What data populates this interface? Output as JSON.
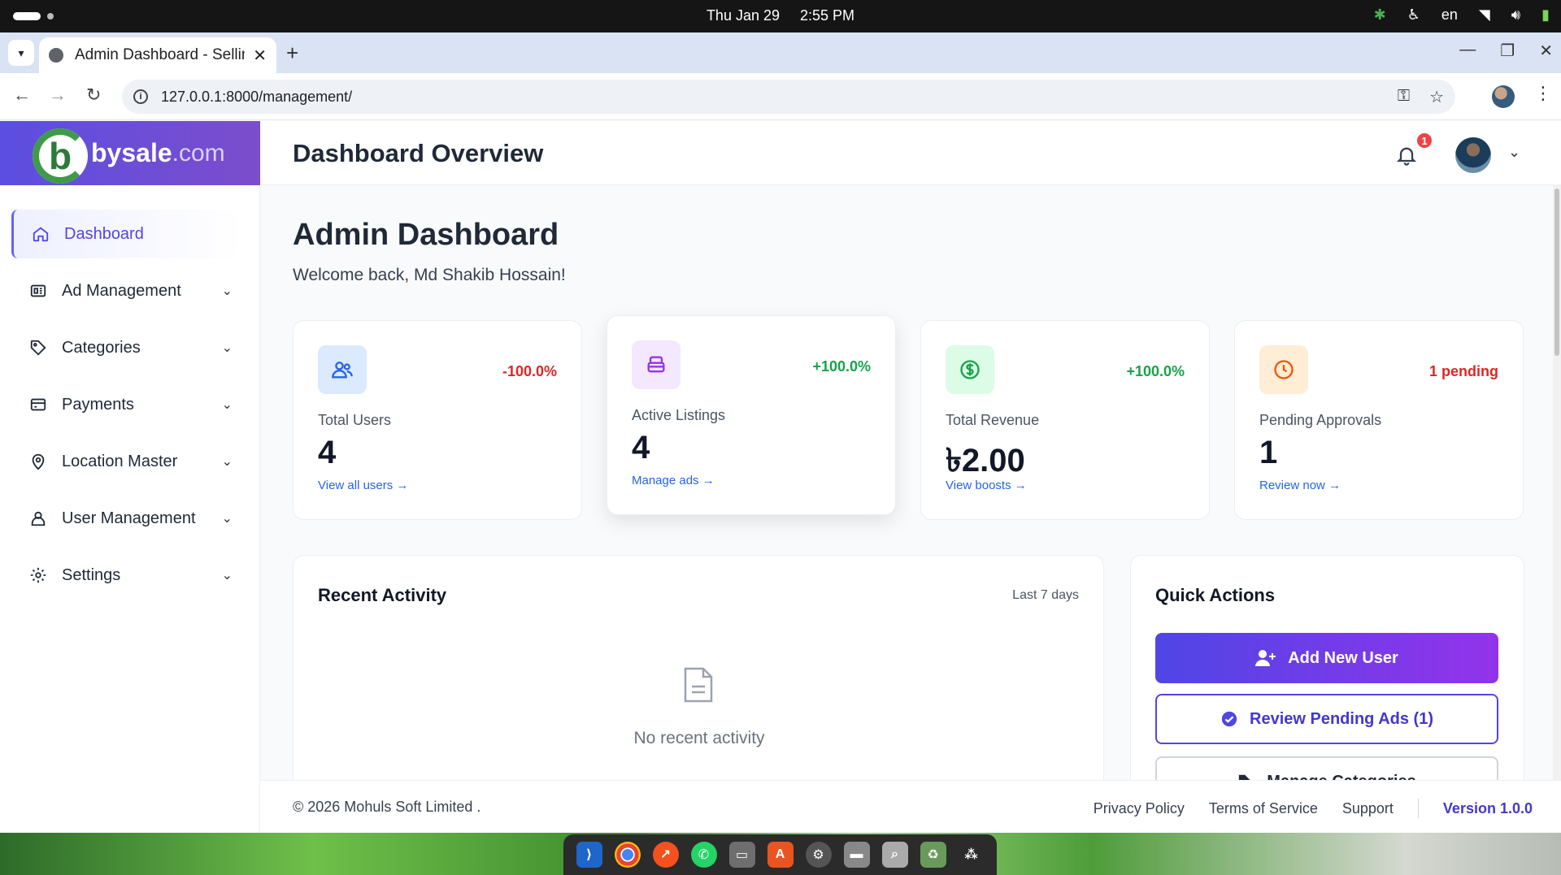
{
  "os": {
    "date": "Thu Jan 29",
    "time": "2:55 PM",
    "lang": "en"
  },
  "browser": {
    "tab_title": "Admin Dashboard - Sellin",
    "url": "127.0.0.1:8000/management/"
  },
  "brand": {
    "logo_letter": "b",
    "name": "bysale",
    "tld": ".com"
  },
  "sidebar": {
    "items": [
      {
        "label": "Dashboard",
        "icon": "home-icon",
        "active": true
      },
      {
        "label": "Ad Management",
        "icon": "ad-icon"
      },
      {
        "label": "Categories",
        "icon": "tag-icon"
      },
      {
        "label": "Payments",
        "icon": "credit-card-icon"
      },
      {
        "label": "Location Master",
        "icon": "location-pin-icon"
      },
      {
        "label": "User Management",
        "icon": "users-icon"
      },
      {
        "label": "Settings",
        "icon": "gear-icon"
      }
    ]
  },
  "header": {
    "title": "Dashboard Overview",
    "notification_count": "1"
  },
  "main": {
    "title": "Admin Dashboard",
    "welcome": "Welcome back, Md Shakib Hossain!"
  },
  "stats": [
    {
      "label": "Total Users",
      "value": "4",
      "change": "-100.0%",
      "link": "View all users →",
      "icon": "users-icon",
      "color": "#dc2626",
      "bg": "#dbeafe",
      "fg": "#2563eb"
    },
    {
      "label": "Active Listings",
      "value": "4",
      "change": "+100.0%",
      "link": "Manage ads →",
      "icon": "inbox-icon",
      "color": "#16a34a",
      "bg": "#f3e8ff",
      "fg": "#9333ea"
    },
    {
      "label": "Total Revenue",
      "value": "৳2.00",
      "change": "+100.0%",
      "link": "View boosts →",
      "icon": "dollar-icon",
      "color": "#16a34a",
      "bg": "#dcfce7",
      "fg": "#16a34a"
    },
    {
      "label": "Pending Approvals",
      "value": "1",
      "change": "1 pending",
      "link": "Review now →",
      "icon": "clock-icon",
      "color": "#dc2626",
      "bg": "#ffedd5",
      "fg": "#ea580c"
    }
  ],
  "activity": {
    "title": "Recent Activity",
    "period": "Last 7 days",
    "empty": "No recent activity"
  },
  "quick_actions": {
    "title": "Quick Actions",
    "add_user": "Add New User",
    "review_pending": "Review Pending Ads (1)",
    "manage_categories": "Manage Categories"
  },
  "footer": {
    "copyright": "© 2026 Mohuls Soft Limited .",
    "privacy": "Privacy Policy",
    "terms": "Terms of Service",
    "support": "Support",
    "version": "Version 1.0.0"
  }
}
